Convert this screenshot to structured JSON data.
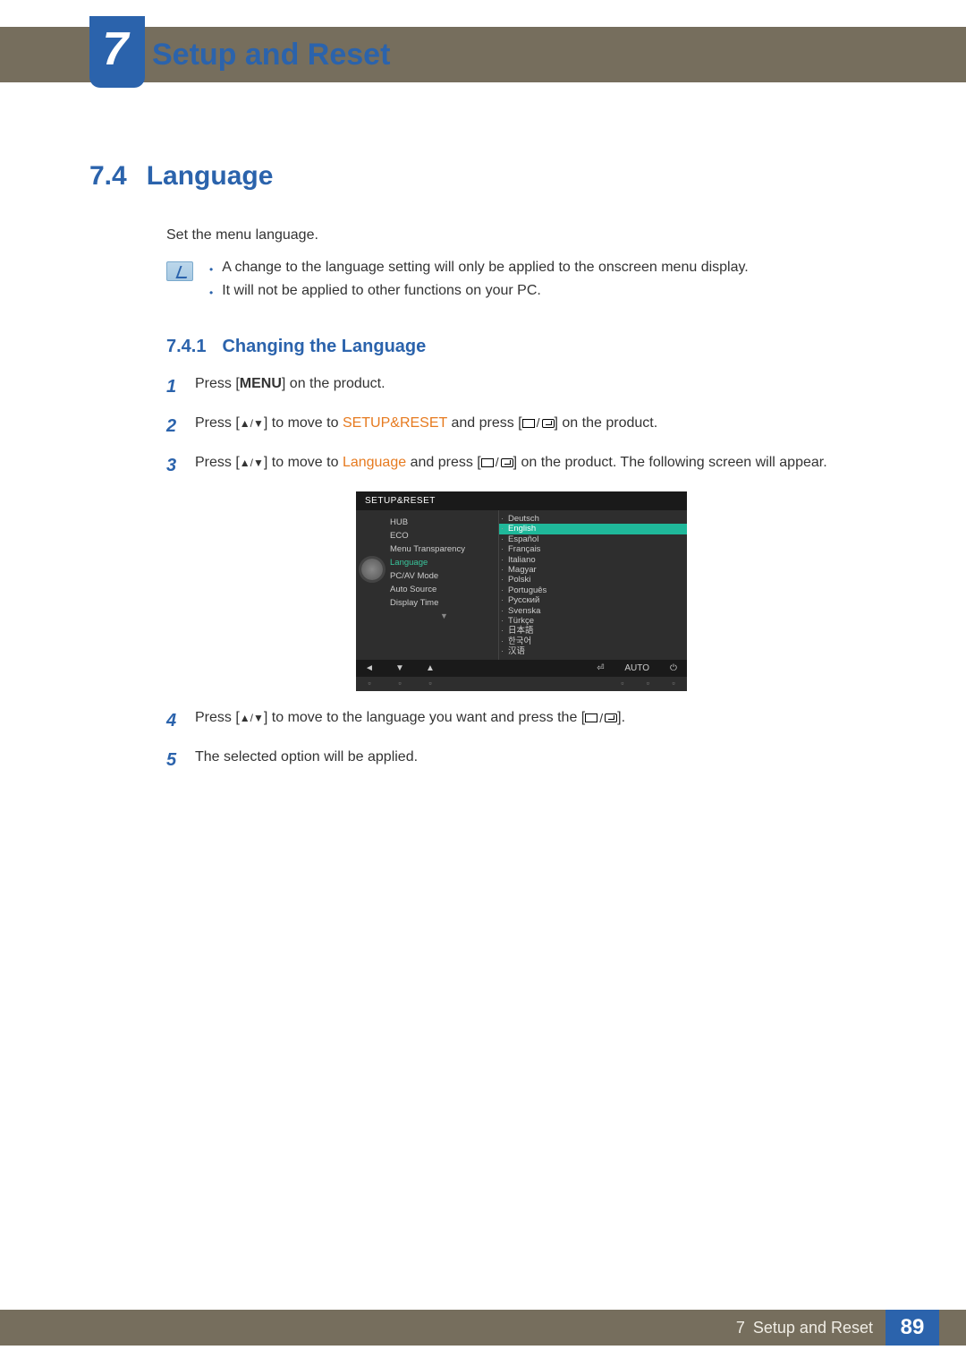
{
  "chapter": {
    "number": "7",
    "title": "Setup and Reset"
  },
  "section": {
    "number": "7.4",
    "title": "Language"
  },
  "intro": "Set the menu language.",
  "notes": [
    "A change to the language setting will only be applied to the onscreen menu display.",
    "It will not be applied to other functions on your PC."
  ],
  "subsection": {
    "number": "7.4.1",
    "title": "Changing the Language"
  },
  "steps": {
    "s1_a": "Press [",
    "s1_menu": "MENU",
    "s1_b": "] on the product.",
    "s2_a": "Press [",
    "s2_arrows": "▲/▼",
    "s2_b": "] to move to ",
    "s2_setup": "SETUP&RESET",
    "s2_c": " and press [",
    "s2_d": "] on the product.",
    "s3_a": "Press [",
    "s3_arrows": "▲/▼",
    "s3_b": "] to move to ",
    "s3_lang": "Language",
    "s3_c": " and press [",
    "s3_d": "] on the product. The following screen will appear.",
    "s4_a": "Press [",
    "s4_arrows": "▲/▼",
    "s4_b": "] to move to the language you want and press the [",
    "s4_c": "].",
    "s5": "The selected option will be applied."
  },
  "step_nums": {
    "n1": "1",
    "n2": "2",
    "n3": "3",
    "n4": "4",
    "n5": "5"
  },
  "osd": {
    "title": "SETUP&RESET",
    "left_items": [
      "HUB",
      "ECO",
      "Menu Transparency",
      "Language",
      "PC/AV Mode",
      "Auto Source",
      "Display Time"
    ],
    "left_selected_index": 3,
    "languages": [
      "Deutsch",
      "English",
      "Español",
      "Français",
      "Italiano",
      "Magyar",
      "Polski",
      "Português",
      "Русский",
      "Svenska",
      "Türkçe",
      "日本語",
      "한국어",
      "汉语"
    ],
    "lang_selected_index": 1,
    "buttons": {
      "back": "◄",
      "down": "▼",
      "up": "▲",
      "enter": "⏎",
      "auto": "AUTO",
      "power": "⏻"
    },
    "arrow_down": "▼"
  },
  "footer": {
    "chapter_label": "7",
    "title": "Setup and Reset",
    "page": "89"
  }
}
